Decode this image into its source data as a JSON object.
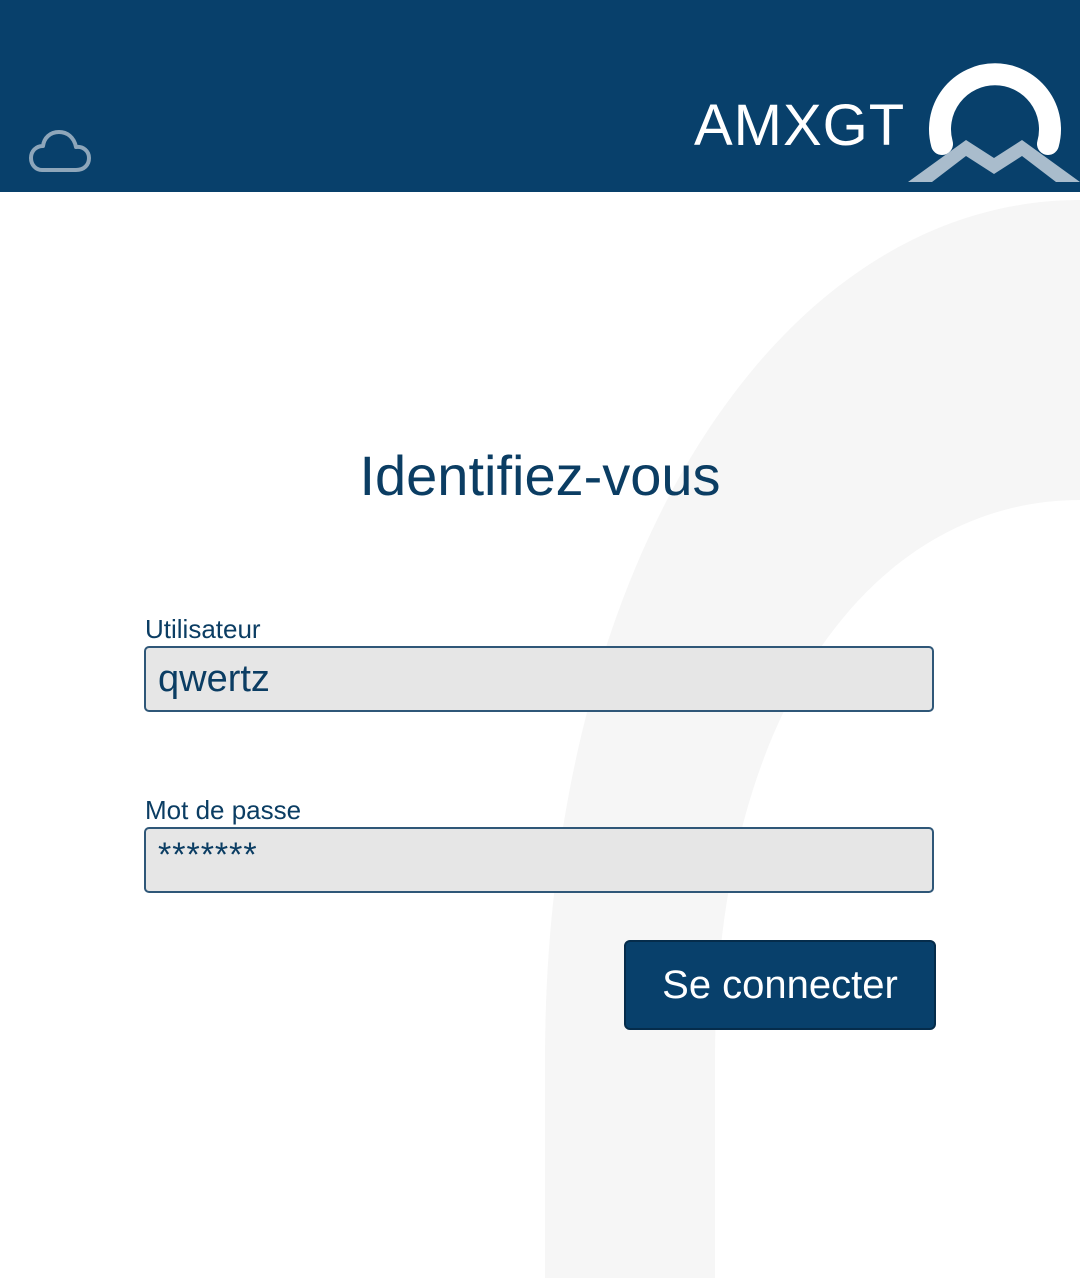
{
  "header": {
    "brand_name": "AMXGT",
    "background_color": "#08406b",
    "cloud_icon": "cloud-icon",
    "logo_icon": "amxgt-logo-icon"
  },
  "login": {
    "title": "Identifiez-vous",
    "username": {
      "label": "Utilisateur",
      "value": "qwertz"
    },
    "password": {
      "label": "Mot de passe",
      "masked_value": "*******"
    },
    "submit_label": "Se connecter"
  },
  "colors": {
    "primary": "#08406b",
    "text": "#0b3d63",
    "field_background": "#e6e6e6"
  }
}
